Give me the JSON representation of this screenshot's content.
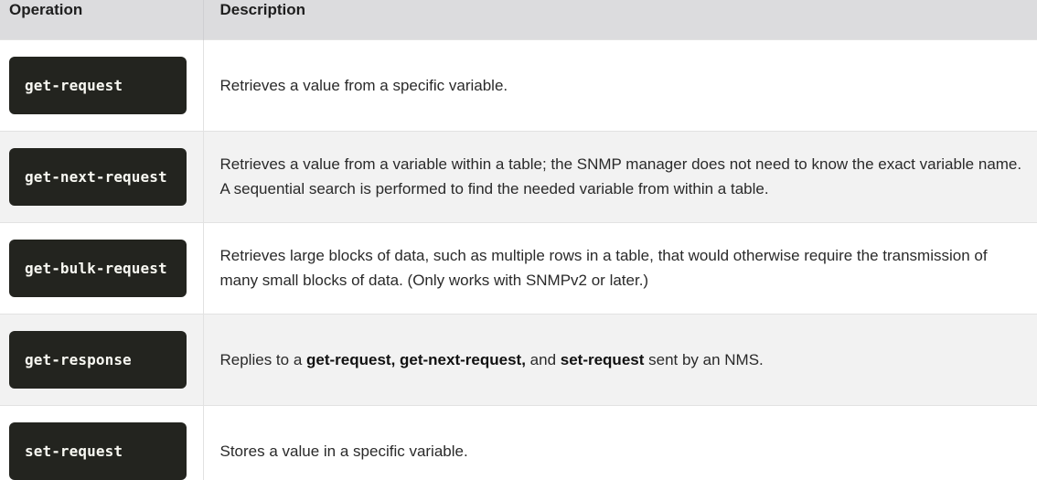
{
  "table": {
    "headers": {
      "operation": "Operation",
      "description": "Description"
    },
    "rows": [
      {
        "operation": "get-request",
        "description": "Retrieves a value from a specific variable."
      },
      {
        "operation": "get-next-request",
        "description": "Retrieves a value from a variable within a table; the SNMP manager does not need to know the exact variable name. A sequential search is performed to find the needed variable from within a table."
      },
      {
        "operation": "get-bulk-request",
        "description": "Retrieves large blocks of data, such as multiple rows in a table, that would otherwise require the transmission of many small blocks of data. (Only works with SNMPv2 or later.)"
      },
      {
        "operation": "get-response",
        "description_parts": {
          "prefix": "Replies to a ",
          "bold1": "get-request, get-next-request,",
          "middle": " and ",
          "bold2": "set-request",
          "suffix": " sent by an NMS."
        }
      },
      {
        "operation": "set-request",
        "description": "Stores a value in a specific variable."
      }
    ]
  },
  "colors": {
    "header_background": "#dcdcde",
    "code_background": "#23241f",
    "code_text": "#f8f8f2",
    "alt_row_background": "#f2f2f2"
  }
}
